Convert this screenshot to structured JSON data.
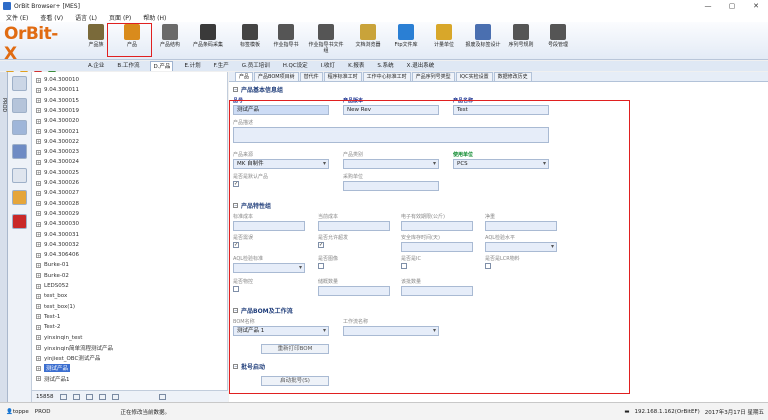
{
  "window": {
    "title": "OrBit Browser+ [MES]",
    "controls": [
      "—",
      "▢",
      "✕"
    ]
  },
  "menu": [
    "文件 (E)",
    "查看 (V)",
    "语言 (L)",
    "页面 (P)",
    "帮助 (H)"
  ],
  "logo": {
    "text": "OrBit-X"
  },
  "toolbar": [
    {
      "label": "产品族",
      "icon": "product-family-icon",
      "color": "#7a6a3a"
    },
    {
      "label": "产品",
      "icon": "product-icon",
      "color": "#d98b1c"
    },
    {
      "label": "产品结构",
      "icon": "product-structure-icon",
      "color": "#6a6a6a"
    },
    {
      "label": "产品条码采集",
      "icon": "barcode-icon",
      "color": "#3a3a3a"
    },
    {
      "label": "标签模板",
      "icon": "label-template-icon",
      "color": "#444"
    },
    {
      "label": "作业指导书",
      "icon": "instruction-book-icon",
      "color": "#555"
    },
    {
      "label": "作业指导书文件组",
      "icon": "instruction-group-icon",
      "color": "#555"
    },
    {
      "label": "文档浏览器",
      "icon": "document-browser-icon",
      "color": "#c9a33a"
    },
    {
      "label": "Ftp文件库",
      "icon": "ftp-icon",
      "color": "#2a7fd4"
    },
    {
      "label": "计量单位",
      "icon": "measure-unit-icon",
      "color": "#d8a72a"
    },
    {
      "label": "报废及标签设计",
      "icon": "scrap-label-icon",
      "color": "#4a6fb0"
    },
    {
      "label": "序列号规则",
      "icon": "serial-rule-icon",
      "color": "#555"
    },
    {
      "label": "号段管理",
      "icon": "number-segment-icon",
      "color": "#555"
    }
  ],
  "module_tabs": [
    "A.企业",
    "B.工作流",
    "D.产品",
    "E.计划",
    "F.生产",
    "G.员工培训",
    "H.QC设定",
    "I.收灯",
    "K.报表",
    "S.系统",
    "X.退出系统"
  ],
  "module_tabs_active": 2,
  "left_strip": {
    "label": "PROD"
  },
  "tree": {
    "items": [
      "9.04.300010",
      "9.04.300011",
      "9.04.300015",
      "9.04.300019",
      "9.04.300020",
      "9.04.300021",
      "9.04.300022",
      "9.04.300023",
      "9.04.300024",
      "9.04.300025",
      "9.04.300026",
      "9.04.300027",
      "9.04.300028",
      "9.04.300029",
      "9.04.300030",
      "9.04.300031",
      "9.04.300032",
      "9.04.306406",
      "Burke-01",
      "Burke-02",
      "LEDS052",
      "test_box",
      "test_box(1)",
      "Test-1",
      "Test-2",
      "yinxinqin_test",
      "yinxinqin简单流程测试产品",
      "yinjiest_OBC测试产品",
      "测试产品",
      "测试产品1"
    ],
    "selected_index": 28,
    "footer_count": "15858"
  },
  "subtabs": [
    "产品",
    "产品BOM项目树",
    "替代件",
    "程序标准工时",
    "工作中心标准工时",
    "产品序列号类型",
    "IQC实检设置",
    "数据修改历史"
  ],
  "subtabs_active": 0,
  "sections": {
    "basic": "产品基本信息组",
    "traits": "产品特性组",
    "bom": "产品BOM及工作流",
    "batch": "批号启动"
  },
  "fields": {
    "product_code": {
      "label": "品号",
      "value": "测试产品"
    },
    "product_version": {
      "label": "产品版本",
      "value": "New Rev"
    },
    "product_name": {
      "label": "产品名称",
      "value": "Test"
    },
    "product_desc": {
      "label": "产品描述",
      "value": ""
    },
    "product_source": {
      "label": "产品来源",
      "value": "MK 自制件"
    },
    "product_category": {
      "label": "产品类别",
      "value": ""
    },
    "use_unit": {
      "label": "使用单位",
      "value": "PCS"
    },
    "is_default": {
      "label": "是否是默认产品",
      "checked": true
    },
    "purchase_unit": {
      "label": "采购单位",
      "value": ""
    },
    "std_cost": {
      "label": "标准成本",
      "value": ""
    },
    "current_cost": {
      "label": "当前成本",
      "value": ""
    },
    "electronic_lifetime": {
      "label": "电子有效期限(公斤)",
      "value": ""
    },
    "net_weight": {
      "label": "净重",
      "value": ""
    },
    "is_expiry": {
      "label": "是否需误",
      "checked": true
    },
    "allow_expire": {
      "label": "是否允许超发",
      "checked": true
    },
    "safe_stock_days": {
      "label": "安全库存时间(天)",
      "value": ""
    },
    "aql_level": {
      "label": "AQL检验水平",
      "value": ""
    },
    "aql_standard": {
      "label": "AQL检验标准",
      "value": ""
    },
    "is_image": {
      "label": "是否图像",
      "checked": false
    },
    "is_ic": {
      "label": "是否是IC",
      "checked": false
    },
    "is_lcr": {
      "label": "是否是LCR物料",
      "checked": false
    },
    "is_shielded": {
      "label": "是否物控",
      "checked": false
    },
    "reserve_qty": {
      "label": "储概数量",
      "value": ""
    },
    "lot_qty": {
      "label": "该批数量",
      "value": ""
    },
    "bom_name": {
      "label": "BOM名称",
      "value": "测试产品 1"
    },
    "workflow_name": {
      "label": "工作流名称",
      "value": ""
    }
  },
  "buttons": {
    "rebuild_bom": "重新打印BOM",
    "batch_start": "启动批号(S)"
  },
  "status": {
    "user": "toppe",
    "module": "PROD",
    "message": "正在修改当前数据。",
    "ip": "192.168.1.162(OrBitEF)",
    "date": "2017年3月17日 星期五"
  }
}
